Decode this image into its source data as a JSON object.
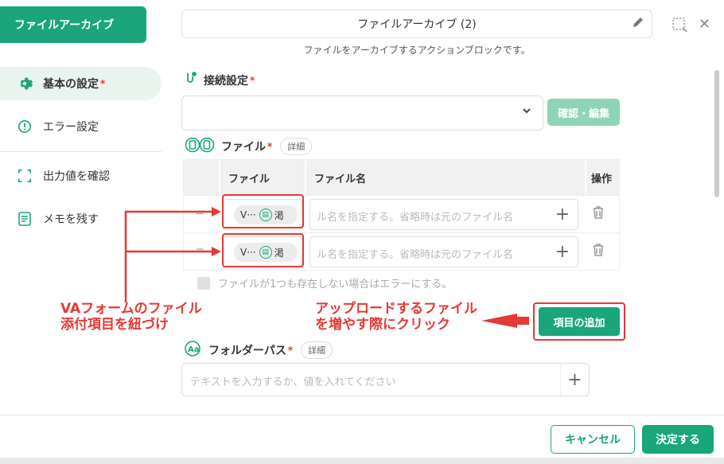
{
  "app_tag": "ファイルアーカイブ",
  "dialog": {
    "title": "ファイルアーカイブ (2)",
    "subtitle": "ファイルをアーカイブするアクションブロックです。"
  },
  "sidebar": {
    "items": [
      {
        "label": "基本の設定",
        "required": "*"
      },
      {
        "label": "エラー設定"
      },
      {
        "label": "出力値を確認"
      },
      {
        "label": "メモを残す"
      }
    ]
  },
  "connection": {
    "title": "接続設定",
    "required": "*",
    "confirm_label": "確認・編集"
  },
  "files": {
    "title": "ファイル",
    "required": "*",
    "detail_badge": "詳細",
    "columns": [
      "ファイル",
      "ファイル名",
      "操作"
    ],
    "rows": [
      {
        "chip": "V···",
        "chip_tail": "渇",
        "placeholder": "ル名を指定する。省略時は元のファイル名"
      },
      {
        "chip": "V···",
        "chip_tail": "渇",
        "placeholder": "ル名を指定する。省略時は元のファイル名"
      }
    ],
    "checkbox_label": "ファイルが1つも存在しない場合はエラーにする。",
    "add_label": "項目の追加"
  },
  "annotations": {
    "left_line1": "VAフォームのファイル",
    "left_line2": "添付項目を紐づけ",
    "right_line1": "アップロードするファイル",
    "right_line2": "を増やす際にクリック"
  },
  "folder": {
    "title": "フォルダーパス",
    "required": "*",
    "detail_badge": "詳細",
    "placeholder": "テキストを入力するか、値を入れてください"
  },
  "footer": {
    "cancel_label": "キャンセル",
    "ok_label": "決定する"
  },
  "colors": {
    "accent": "#1aa57a",
    "annotation": "#e53935"
  }
}
